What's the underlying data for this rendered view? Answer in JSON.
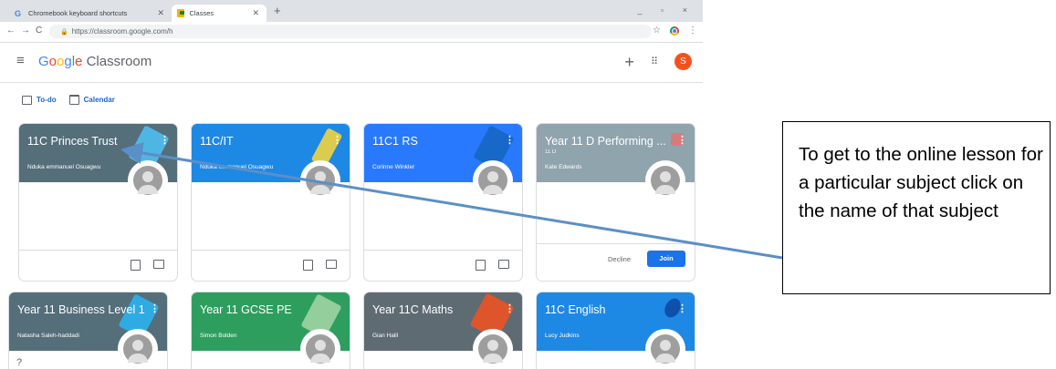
{
  "browser": {
    "tabs": [
      {
        "title": "Chromebook keyboard shortcuts",
        "active": false,
        "favicon": "google-g-icon"
      },
      {
        "title": "Classes",
        "active": true,
        "favicon": "classroom-icon"
      }
    ],
    "url": "https://classroom.google.com/h",
    "window_controls": "_  ▫  ×"
  },
  "app": {
    "brand_google": "Google",
    "brand_product": "Classroom",
    "account_initial": "S",
    "accent": "#1a73e8"
  },
  "subnav": {
    "todo": "To-do",
    "calendar": "Calendar"
  },
  "cards": [
    {
      "title": "11C Princes Trust",
      "section": "",
      "teacher": "Nduka emmanuel Osuagwu",
      "color": "#546e7a",
      "type": "enrolled"
    },
    {
      "title": "11C/IT",
      "section": "",
      "teacher": "Nduka emmanuel Osuagwu",
      "color": "#1e88e5",
      "type": "enrolled"
    },
    {
      "title": "11C1 RS",
      "section": "",
      "teacher": "Corinne Winkler",
      "color": "#2979ff",
      "type": "enrolled"
    },
    {
      "title": "Year 11 D Performing ...",
      "section": "11 D",
      "teacher": "Kate Edwards",
      "color": "#90a4ae",
      "type": "invite",
      "decline": "Decline",
      "join": "Join"
    },
    {
      "title": "Year 11 Business Level 1",
      "section": "",
      "teacher": "Natasha Saleh-haddadi",
      "color": "#546e7a",
      "type": "partial"
    },
    {
      "title": "Year 11 GCSE PE",
      "section": "",
      "teacher": "Simon Bolden",
      "color": "#2e9e5f",
      "type": "partial"
    },
    {
      "title": "Year 11C Maths",
      "section": "",
      "teacher": "Gian Halil",
      "color": "#5f6b73",
      "type": "partial"
    },
    {
      "title": "11C English",
      "section": "",
      "teacher": "Lucy Judkins",
      "color": "#1e88e5",
      "type": "partial"
    }
  ],
  "callout": {
    "text": "To get to the online lesson for a particular subject click on the name of that subject"
  }
}
